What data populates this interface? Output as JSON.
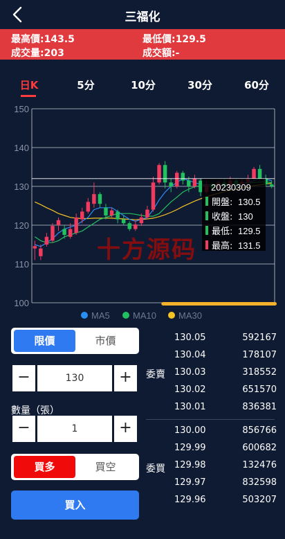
{
  "header": {
    "title": "三福化",
    "back_icon": "chevron-left-icon"
  },
  "stats": {
    "high": "最高價:143.5",
    "low": "最低價:129.5",
    "volume": "成交量:203",
    "amount": "成交額:-"
  },
  "tabs": [
    {
      "label": "日K",
      "active": true
    },
    {
      "label": "5分",
      "active": false
    },
    {
      "label": "10分",
      "active": false
    },
    {
      "label": "30分",
      "active": false
    },
    {
      "label": "60分",
      "active": false
    }
  ],
  "chart_data": {
    "type": "candlestick",
    "ylim": [
      100,
      150
    ],
    "y_ticks": [
      "150",
      "140",
      "130",
      "120",
      "110",
      "100"
    ],
    "candles": [
      [
        114,
        114.6,
        111,
        116
      ],
      [
        112,
        114,
        111,
        115
      ],
      [
        115,
        117,
        114.5,
        118
      ],
      [
        116,
        119.8,
        115.5,
        120.5
      ],
      [
        120,
        121.3,
        118.5,
        122
      ],
      [
        119,
        117.5,
        116.5,
        120
      ],
      [
        117,
        119,
        116.5,
        120.5
      ],
      [
        118,
        122,
        117.5,
        123
      ],
      [
        121.5,
        123.5,
        120.5,
        124.5
      ],
      [
        123.5,
        126,
        123,
        127
      ],
      [
        125.5,
        128,
        124.5,
        131
      ],
      [
        128,
        125.5,
        124.5,
        128.5
      ],
      [
        124.5,
        122.5,
        121.5,
        125.5
      ],
      [
        122.5,
        123.8,
        122,
        124.5
      ],
      [
        123.5,
        121.5,
        120.5,
        124
      ],
      [
        121.5,
        120.5,
        120,
        122.5
      ],
      [
        120.5,
        119,
        118.5,
        121
      ],
      [
        119,
        120.2,
        118.5,
        121.5
      ],
      [
        120.5,
        122,
        119.8,
        123
      ],
      [
        122,
        124,
        121.5,
        125
      ],
      [
        124,
        131,
        123.5,
        132.5
      ],
      [
        131,
        135.5,
        130.5,
        136
      ],
      [
        135.5,
        131,
        129.5,
        136.5
      ],
      [
        131,
        130,
        128.5,
        132
      ],
      [
        130,
        133.5,
        129.5,
        134
      ],
      [
        133.5,
        131.5,
        130.5,
        134
      ],
      [
        131.5,
        130,
        128.5,
        132.5
      ],
      [
        130,
        132,
        129.5,
        133
      ],
      [
        131.5,
        128.5,
        127.5,
        132
      ],
      [
        128.5,
        130.5,
        128,
        131.5
      ],
      [
        130.5,
        129.5,
        128.5,
        131
      ],
      [
        129.5,
        131,
        128.8,
        131.5
      ],
      [
        131,
        130,
        129,
        132
      ],
      [
        130,
        131.5,
        129.5,
        132.5
      ],
      [
        131.5,
        130.5,
        129.5,
        132
      ],
      [
        130.5,
        131.2,
        130,
        132
      ],
      [
        131,
        132,
        130.5,
        133
      ],
      [
        132,
        134.5,
        131.5,
        135
      ],
      [
        134.5,
        132,
        131.5,
        135.5
      ],
      [
        132,
        130.5,
        130,
        133
      ],
      [
        130.5,
        130,
        129.5,
        131.5
      ]
    ],
    "ma5": [
      115,
      114.5,
      115.5,
      116.5,
      118,
      119,
      119.5,
      120,
      121,
      122,
      124,
      124.5,
      124.5,
      124.5,
      123.5,
      122.5,
      121.5,
      121,
      121.5,
      122,
      124,
      126.5,
      128.5,
      130,
      131,
      132,
      131.5,
      131,
      130.5,
      130.5,
      130.3,
      130.2,
      130.2,
      130.5,
      130.6,
      130.8,
      131,
      131.5,
      132,
      131.8,
      131.5
    ],
    "ma10": [
      117,
      116,
      115.5,
      115.5,
      116,
      117,
      117.5,
      118,
      118.5,
      119.5,
      120.5,
      121.5,
      122,
      122.5,
      123,
      123,
      123,
      122.8,
      122.5,
      122.3,
      122.3,
      123,
      124.5,
      126,
      127.2,
      128.5,
      129.3,
      129.9,
      130.2,
      130.4,
      130.5,
      130.5,
      130.5,
      130.6,
      130.7,
      130.8,
      130.9,
      131,
      131.1,
      131.1,
      131
    ],
    "ma30": [
      126,
      125.3,
      124.5,
      123.8,
      123,
      122.5,
      122,
      121.8,
      121.7,
      121.7,
      121.8,
      121.8,
      121.8,
      121.8,
      121.7,
      121.6,
      121.5,
      121.4,
      121.5,
      121.6,
      121.8,
      122.2,
      122.7,
      123.3,
      124,
      124.8,
      125.5,
      126.2,
      126.8,
      127.3,
      127.8,
      128.2,
      128.6,
      129,
      129.3,
      129.6,
      129.9,
      130.2,
      130.4,
      130.6,
      130.8
    ],
    "highlight_index": 38,
    "legend": [
      "MA5",
      "MA10",
      "MA30"
    ],
    "colors": {
      "MA5": "#2a8ef5",
      "MA10": "#23c05f",
      "MA30": "#f5c322",
      "up": "#ef3b5f",
      "down": "#23c05f",
      "grid": "#c9ccd4"
    },
    "tooltip": {
      "date": "20230309",
      "rows": [
        {
          "label": "開盤:",
          "value": "130.5",
          "color": "#23c05f"
        },
        {
          "label": "收盤:",
          "value": "130",
          "color": "#23c05f"
        },
        {
          "label": "最低:",
          "value": "129.5",
          "color": "#23c05f"
        },
        {
          "label": "最高:",
          "value": "131.5",
          "color": "#ef3b5f"
        }
      ]
    },
    "scroll_progress": 0.7,
    "watermark": "十方源码"
  },
  "order": {
    "price_type": {
      "options": [
        "限價",
        "市價"
      ],
      "selected": 0
    },
    "price": {
      "value": "130",
      "minus": "−",
      "plus": "+"
    },
    "quantity_label": "數量（張）",
    "quantity": {
      "value": "1",
      "minus": "−",
      "plus": "+"
    },
    "side": {
      "options": [
        "買多",
        "買空"
      ],
      "selected": 0
    },
    "submit": "買入"
  },
  "book": {
    "ask_label": "委賣",
    "bid_label": "委買",
    "asks": [
      {
        "price": "130.05",
        "volume": "592167"
      },
      {
        "price": "130.04",
        "volume": "178107"
      },
      {
        "price": "130.03",
        "volume": "318552"
      },
      {
        "price": "130.02",
        "volume": "651570"
      },
      {
        "price": "130.01",
        "volume": "836381"
      }
    ],
    "bids": [
      {
        "price": "130.00",
        "volume": "856766"
      },
      {
        "price": "129.99",
        "volume": "600682"
      },
      {
        "price": "129.98",
        "volume": "132476"
      },
      {
        "price": "129.97",
        "volume": "832598"
      },
      {
        "price": "129.96",
        "volume": "503207"
      }
    ]
  }
}
